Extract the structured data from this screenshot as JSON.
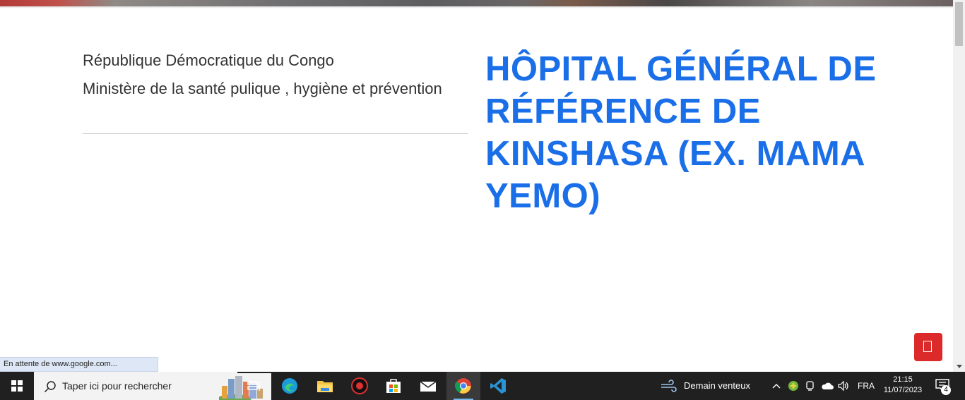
{
  "header": {
    "country": "République Démocratique du Congo",
    "ministry": "Ministère de la santé pulique , hygiène et prévention",
    "hospital_title": "HÔPITAL GÉNÉRAL DE RÉFÉRENCE DE KINSHASA (EX. MAMA YEMO)"
  },
  "status_bar": {
    "text": "En attente de www.google.com..."
  },
  "colors": {
    "title_blue": "#1a6fe8",
    "fab_red": "#dc2a2a"
  },
  "taskbar": {
    "search_placeholder": "Taper ici pour rechercher",
    "weather": "Demain venteux",
    "language": "FRA",
    "time": "21:15",
    "date": "11/07/2023",
    "notification_count": "4",
    "pinned": [
      "task-view-icon",
      "edge-icon",
      "file-explorer-icon",
      "app-red-icon",
      "store-icon",
      "mail-icon",
      "chrome-icon",
      "vscode-icon"
    ]
  }
}
